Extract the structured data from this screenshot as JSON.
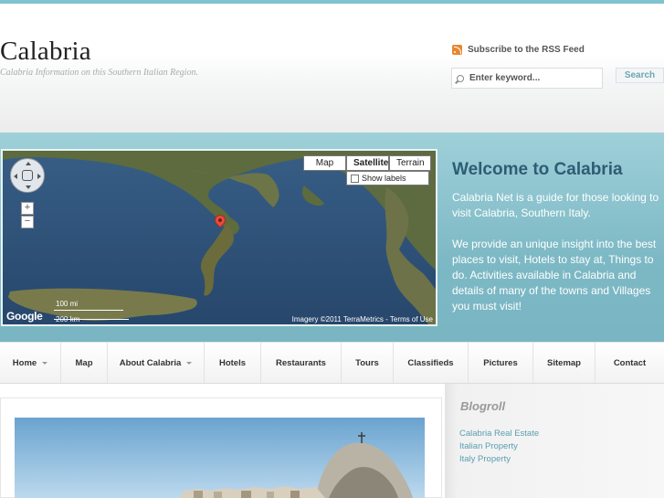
{
  "header": {
    "site_title": "Calabria",
    "tagline": "Calabria Information on this Southern Italian Region.",
    "rss_label": "Subscribe to the RSS Feed",
    "search": {
      "placeholder": "Enter keyword...",
      "button_label": "Search"
    }
  },
  "map": {
    "types": [
      "Map",
      "Satellite",
      "Terrain"
    ],
    "active_type": "Satellite",
    "show_labels": "Show labels",
    "scale": {
      "miles": "100 mi",
      "km": "200 km"
    },
    "logo": "Google",
    "attribution": "Imagery ©2011 TerraMetrics - Terms of Use",
    "zoom_in": "+",
    "zoom_out": "−"
  },
  "welcome": {
    "title": "Welcome to Calabria",
    "paragraph1": "Calabria Net is a guide for those looking to visit Calabria, Southern Italy.",
    "paragraph2": "We provide an unique insight into the best places to visit, Hotels to stay at, Things to do. Activities available in Calabria and details of many of the towns and Villages you must visit!"
  },
  "nav": {
    "items": [
      {
        "label": "Home",
        "has_dropdown": true
      },
      {
        "label": "Map",
        "has_dropdown": false
      },
      {
        "label": "About Calabria",
        "has_dropdown": true
      },
      {
        "label": "Hotels",
        "has_dropdown": false
      },
      {
        "label": "Restaurants",
        "has_dropdown": false
      },
      {
        "label": "Tours",
        "has_dropdown": false
      },
      {
        "label": "Classifieds",
        "has_dropdown": false
      },
      {
        "label": "Pictures",
        "has_dropdown": false
      },
      {
        "label": "Sitemap",
        "has_dropdown": false
      },
      {
        "label": "Contact",
        "has_dropdown": false
      }
    ]
  },
  "sidebar": {
    "blogroll_title": "Blogroll",
    "links": [
      "Calabria Real Estate",
      "Italian Property",
      "Italy Property"
    ]
  },
  "colors": {
    "accent": "#7fc3cf",
    "welcome_title": "#2d5d74",
    "link": "#5a9fb0",
    "rss": "#e8862f"
  }
}
